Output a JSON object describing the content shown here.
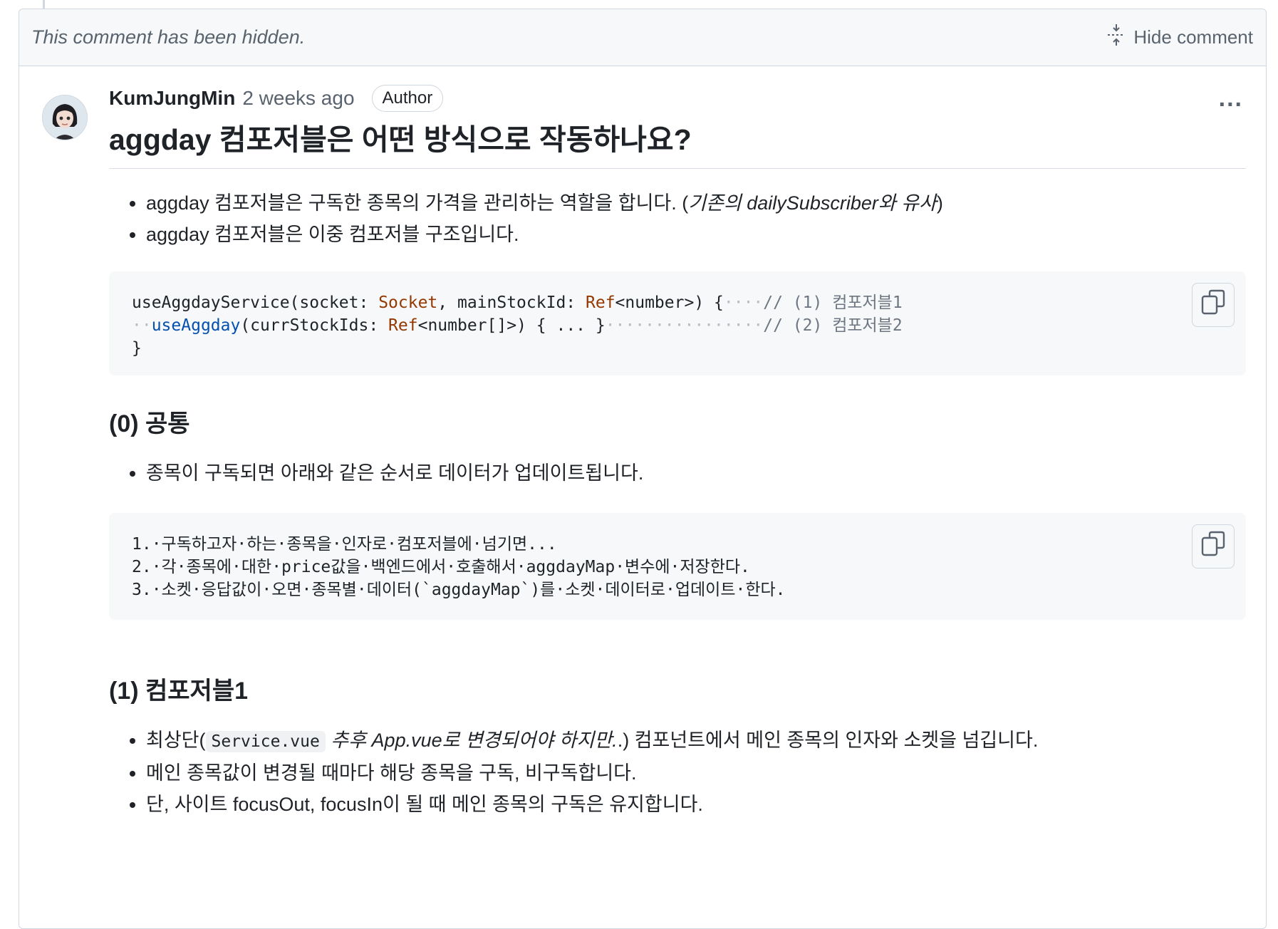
{
  "hidden_comment": {
    "text": "This comment has been hidden.",
    "hide_label": "Hide comment"
  },
  "comment": {
    "author": "KumJungMin",
    "time": "2 weeks ago",
    "badge": "Author",
    "more_label": "...",
    "title": "aggday 컴포저블은 어떤 방식으로 작동하나요?"
  },
  "intro_bullets": {
    "b1_text": "aggday 컴포저블은 구독한 종목의 가격을 관리하는 역할을 합니다. (",
    "b1_em": "기존의 dailySubscriber와 유사",
    "b1_end": ")",
    "b2": "aggday 컴포저블은 이중 컴포저블 구조입니다."
  },
  "code1": {
    "l1_fn": "useAggdayService(socket: ",
    "l1_type1": "Socket",
    "l1_mid": ", mainStockId: ",
    "l1_type2": "Ref",
    "l1_gen": "<number>",
    "l1_end": ") {",
    "l1_ws": "····",
    "l1_cmt": "// (1) 컴포저블1",
    "l2_ws": "··",
    "l2_fn": "useAggday",
    "l2_mid": "(currStockIds: ",
    "l2_type": "Ref",
    "l2_gen": "<number[]>",
    "l2_end": ") { ... }",
    "l2_ws2": "················",
    "l2_cmt": "// (2) 컴포저블2",
    "l3": "}"
  },
  "section0": {
    "heading": "(0) 공통",
    "bullet": "종목이 구독되면 아래와 같은 순서로 데이터가 업데이트됩니다."
  },
  "code2": {
    "l1": "1.·구독하고자·하는·종목을·인자로·컴포저블에·넘기면...",
    "l2": "2.·각·종목에·대한·price값을·백엔드에서·호출해서·aggdayMap·변수에·저장한다.",
    "l3": "3.·소켓·응답값이·오면·종목별·데이터(`aggdayMap`)를·소켓·데이터로·업데이트·한다."
  },
  "section1": {
    "heading": "(1) 컴포저블1",
    "b1_pre": "최상단(",
    "b1_code": "Service.vue",
    "b1_em": "추후 App.vue로 변경되어야 하지만.",
    "b1_post": ".) 컴포넌트에서 메인 종목의 인자와 소켓을 넘깁니다.",
    "b2": "메인 종목값이 변경될 때마다 해당 종목을 구독, 비구독합니다.",
    "b3": "단, 사이트 focusOut, focusIn이 될 때 메인 종목의 구독은 유지합니다."
  }
}
